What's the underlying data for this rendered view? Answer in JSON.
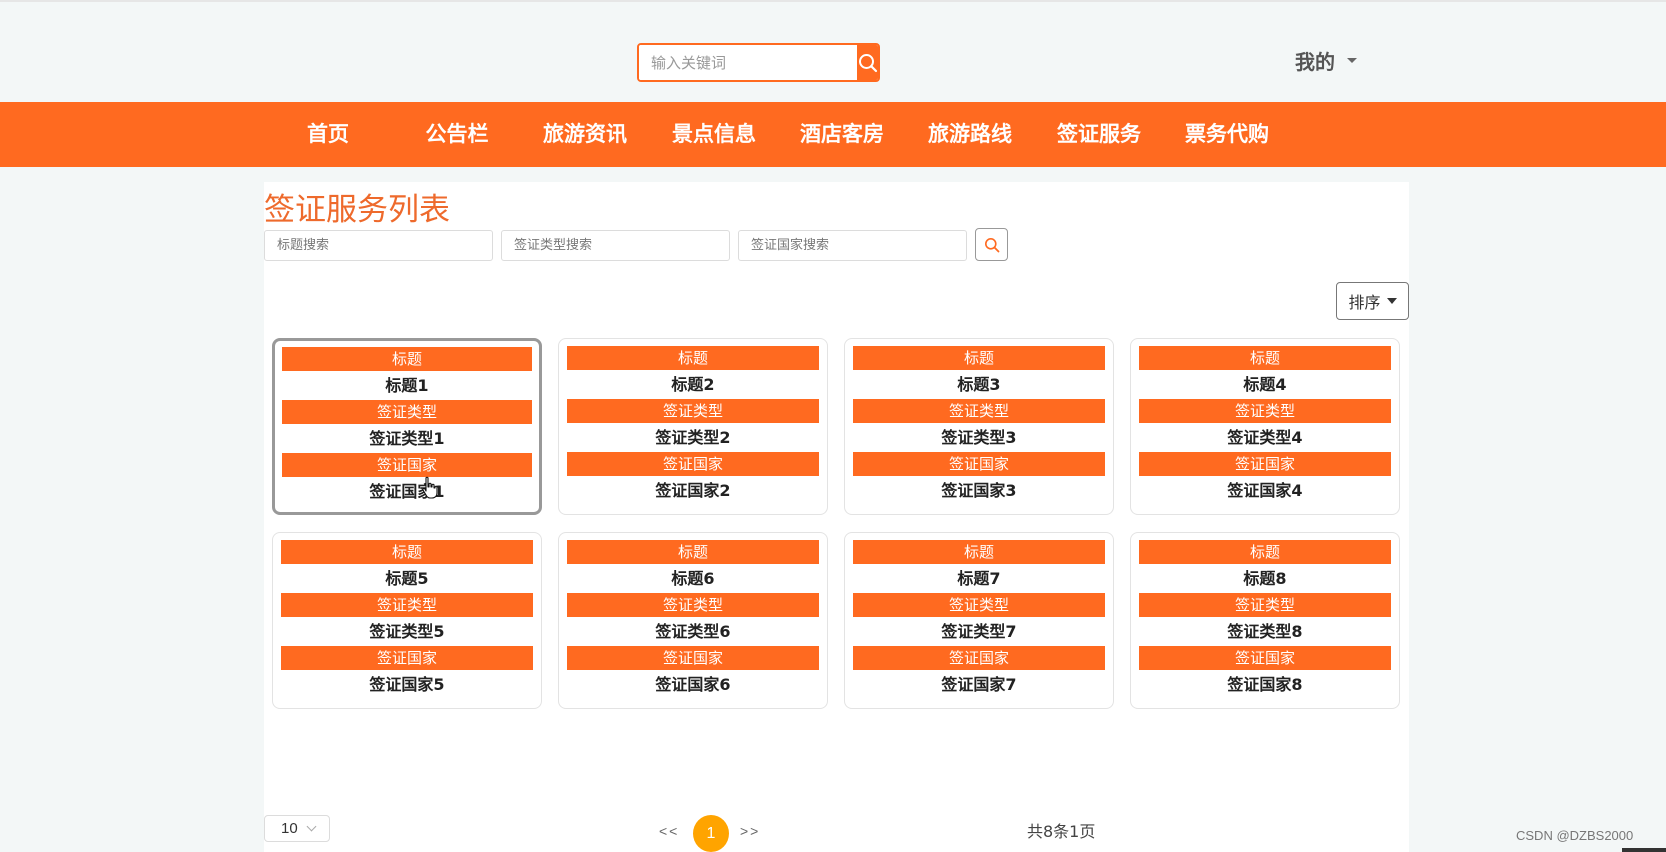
{
  "header": {
    "search_placeholder": "输入关键词",
    "my_label": "我的"
  },
  "nav": {
    "items": [
      "首页",
      "公告栏",
      "旅游资讯",
      "景点信息",
      "酒店客房",
      "旅游路线",
      "签证服务",
      "票务代购"
    ]
  },
  "main": {
    "title": "签证服务列表",
    "filters": {
      "title_placeholder": "标题搜索",
      "type_placeholder": "签证类型搜索",
      "country_placeholder": "签证国家搜索"
    },
    "sort_label": "排序",
    "card_labels": {
      "title": "标题",
      "type": "签证类型",
      "country": "签证国家"
    },
    "cards": [
      {
        "title": "标题1",
        "type": "签证类型1",
        "country": "签证国家1"
      },
      {
        "title": "标题2",
        "type": "签证类型2",
        "country": "签证国家2"
      },
      {
        "title": "标题3",
        "type": "签证类型3",
        "country": "签证国家3"
      },
      {
        "title": "标题4",
        "type": "签证类型4",
        "country": "签证国家4"
      },
      {
        "title": "标题5",
        "type": "签证类型5",
        "country": "签证国家5"
      },
      {
        "title": "标题6",
        "type": "签证类型6",
        "country": "签证国家6"
      },
      {
        "title": "标题7",
        "type": "签证类型7",
        "country": "签证国家7"
      },
      {
        "title": "标题8",
        "type": "签证类型8",
        "country": "签证国家8"
      }
    ]
  },
  "pagination": {
    "page_size": "10",
    "prev": "<<",
    "current_page": "1",
    "next": ">>",
    "total_text": "共8条1页"
  },
  "watermark": "CSDN @DZBS2000",
  "colors": {
    "accent": "#ff6a20",
    "page_active": "#ffa400",
    "title": "#ee6a2c"
  }
}
